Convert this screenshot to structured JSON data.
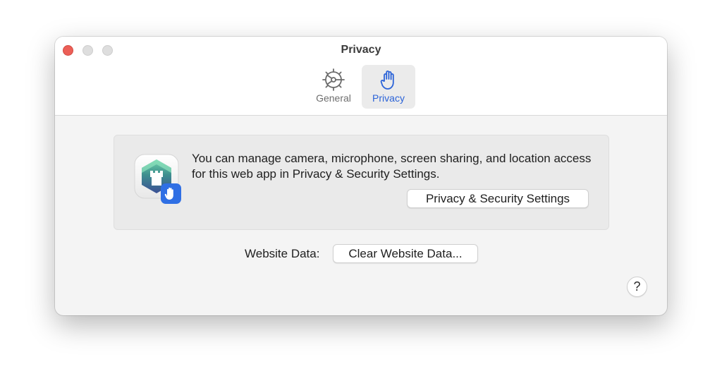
{
  "window": {
    "title": "Privacy"
  },
  "toolbar": {
    "tabs": [
      {
        "label": "General",
        "icon": "gear-icon",
        "selected": false
      },
      {
        "label": "Privacy",
        "icon": "hand-icon",
        "selected": true
      }
    ]
  },
  "privacy_info": {
    "message": "You can manage camera, microphone, screen sharing, and location access for this web app in Privacy & Security Settings.",
    "button_label": "Privacy & Security Settings",
    "app_icon": "web-app-privacy-icon"
  },
  "website_data": {
    "label": "Website Data:",
    "button_label": "Clear Website Data..."
  },
  "help": {
    "label": "?"
  },
  "colors": {
    "accent": "#2b63d8",
    "close_button": "#ec5f57",
    "window_background": "#f4f4f4",
    "panel_background": "#eaeaea"
  }
}
